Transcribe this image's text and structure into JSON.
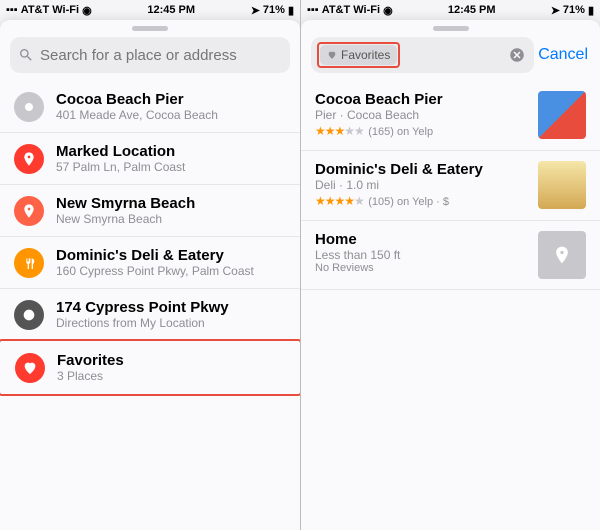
{
  "status": {
    "carrier": "AT&T Wi-Fi",
    "time": "12:45 PM",
    "battery": "71%"
  },
  "left": {
    "search": {
      "placeholder": "Search for a place or address"
    },
    "items": [
      {
        "title": "Cocoa Beach Pier",
        "sub": "401 Meade Ave, Cocoa Beach"
      },
      {
        "title": "Marked Location",
        "sub": "57 Palm Ln, Palm Coast"
      },
      {
        "title": "New Smyrna Beach",
        "sub": "New Smyrna Beach"
      },
      {
        "title": "Dominic's Deli & Eatery",
        "sub": "160 Cypress Point Pkwy, Palm Coast"
      },
      {
        "title": "174 Cypress Point Pkwy",
        "sub": "Directions from My Location"
      },
      {
        "title": "Favorites",
        "sub": "3 Places"
      }
    ]
  },
  "right": {
    "chip": "Favorites",
    "cancel": "Cancel",
    "results": [
      {
        "title": "Cocoa Beach Pier",
        "sub": "Pier · Cocoa Beach",
        "rating": 3,
        "reviews": "(165) on Yelp"
      },
      {
        "title": "Dominic's Deli & Eatery",
        "sub": "Deli · 1.0 mi",
        "rating": 4.5,
        "reviews": "(105) on Yelp · $"
      },
      {
        "title": "Home",
        "sub": "Less than 150 ft",
        "reviews": "No Reviews"
      }
    ]
  }
}
